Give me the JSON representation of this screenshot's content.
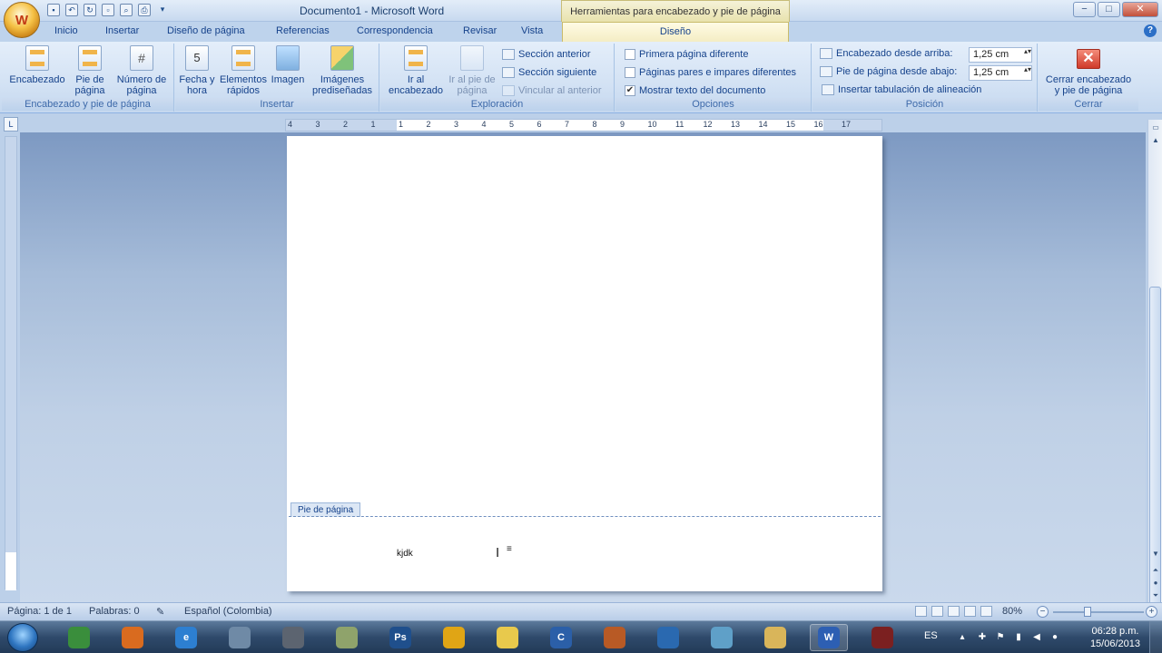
{
  "title_bar": {
    "document_title": "Documento1 - Microsoft Word",
    "context_tab_group": "Herramientas para encabezado y pie de página",
    "office_button_letter": "W",
    "window_buttons": {
      "minimize": "−",
      "maximize": "□",
      "close": "✕"
    }
  },
  "tabs": [
    {
      "label": "Inicio"
    },
    {
      "label": "Insertar"
    },
    {
      "label": "Diseño de página"
    },
    {
      "label": "Referencias"
    },
    {
      "label": "Correspondencia"
    },
    {
      "label": "Revisar"
    },
    {
      "label": "Vista"
    },
    {
      "label": "Diseño",
      "active": true
    }
  ],
  "ribbon": {
    "group_header_footer": {
      "label": "Encabezado y pie de página",
      "buttons": [
        {
          "label": "Encabezado",
          "icon": "header-icon"
        },
        {
          "label": "Pie de página",
          "icon": "footer-icon"
        },
        {
          "label": "Número de página",
          "icon": "page-number-icon"
        }
      ]
    },
    "group_insert": {
      "label": "Insertar",
      "buttons": [
        {
          "label": "Fecha y hora",
          "icon": "calendar-icon"
        },
        {
          "label": "Elementos rápidos",
          "icon": "quick-parts-icon"
        },
        {
          "label": "Imagen",
          "icon": "picture-icon"
        },
        {
          "label": "Imágenes prediseñadas",
          "icon": "clipart-icon"
        }
      ]
    },
    "group_navigation": {
      "label": "Exploración",
      "go_to_header": "Ir al encabezado",
      "go_to_footer": "Ir al pie de página",
      "previous_section": "Sección anterior",
      "next_section": "Sección siguiente",
      "link_to_previous": "Vincular al anterior"
    },
    "group_options": {
      "label": "Opciones",
      "different_first_page": {
        "label": "Primera página diferente",
        "checked": false
      },
      "different_odd_even": {
        "label": "Páginas pares e impares diferentes",
        "checked": false
      },
      "show_document_text": {
        "label": "Mostrar texto del documento",
        "checked": true
      }
    },
    "group_position": {
      "label": "Posición",
      "header_from_top_label": "Encabezado desde arriba:",
      "header_from_top_value": "1,25 cm",
      "footer_from_bottom_label": "Pie de página desde abajo:",
      "footer_from_bottom_value": "1,25 cm",
      "insert_alignment_tab": "Insertar tabulación de alineación"
    },
    "group_close": {
      "label": "Cerrar",
      "close_button": "Cerrar encabezado y pie de página"
    }
  },
  "ruler": {
    "tab_selector": "L",
    "numbers": [
      "4",
      "3",
      "2",
      "1",
      "1",
      "2",
      "3",
      "4",
      "5",
      "6",
      "7",
      "8",
      "9",
      "10",
      "11",
      "12",
      "13",
      "14",
      "15",
      "16",
      "17"
    ]
  },
  "document": {
    "footer_tag": "Pie de página",
    "footer_text": "kjdk"
  },
  "status_bar": {
    "page": "Página: 1 de 1",
    "words": "Palabras: 0",
    "language": "Español (Colombia)",
    "zoom": "80%"
  },
  "taskbar": {
    "apps": [
      {
        "name": "chrome",
        "glyph": "",
        "color": "#3a8e3c",
        "active": false
      },
      {
        "name": "firefox",
        "glyph": "",
        "color": "#d96b1f",
        "active": false
      },
      {
        "name": "internet-explorer",
        "glyph": "e",
        "color": "#2d7fd1",
        "active": false
      },
      {
        "name": "network",
        "glyph": "",
        "color": "#6f8aa6",
        "active": false
      },
      {
        "name": "camera",
        "glyph": "",
        "color": "#5c6470",
        "active": false
      },
      {
        "name": "notes",
        "glyph": "",
        "color": "#8fa36b",
        "active": false
      },
      {
        "name": "photoshop",
        "glyph": "Ps",
        "color": "#1f4f8c",
        "active": false
      },
      {
        "name": "media",
        "glyph": "",
        "color": "#e0a515",
        "active": false
      },
      {
        "name": "sticky-notes",
        "glyph": "",
        "color": "#e8c94c",
        "active": false
      },
      {
        "name": "ccleaner",
        "glyph": "C",
        "color": "#2b5fa8",
        "active": false
      },
      {
        "name": "game",
        "glyph": "",
        "color": "#b85a25",
        "active": false
      },
      {
        "name": "globe",
        "glyph": "",
        "color": "#2a69b0",
        "active": false
      },
      {
        "name": "editor",
        "glyph": "",
        "color": "#5fa0c8",
        "active": false
      },
      {
        "name": "explorer",
        "glyph": "",
        "color": "#d9b55a",
        "active": false
      },
      {
        "name": "word",
        "glyph": "W",
        "color": "#2d5fb3",
        "active": true
      },
      {
        "name": "recorder",
        "glyph": "",
        "color": "#7b2020",
        "active": false
      }
    ],
    "language": "ES",
    "time": "06:28 p.m.",
    "date": "15/06/2013"
  }
}
